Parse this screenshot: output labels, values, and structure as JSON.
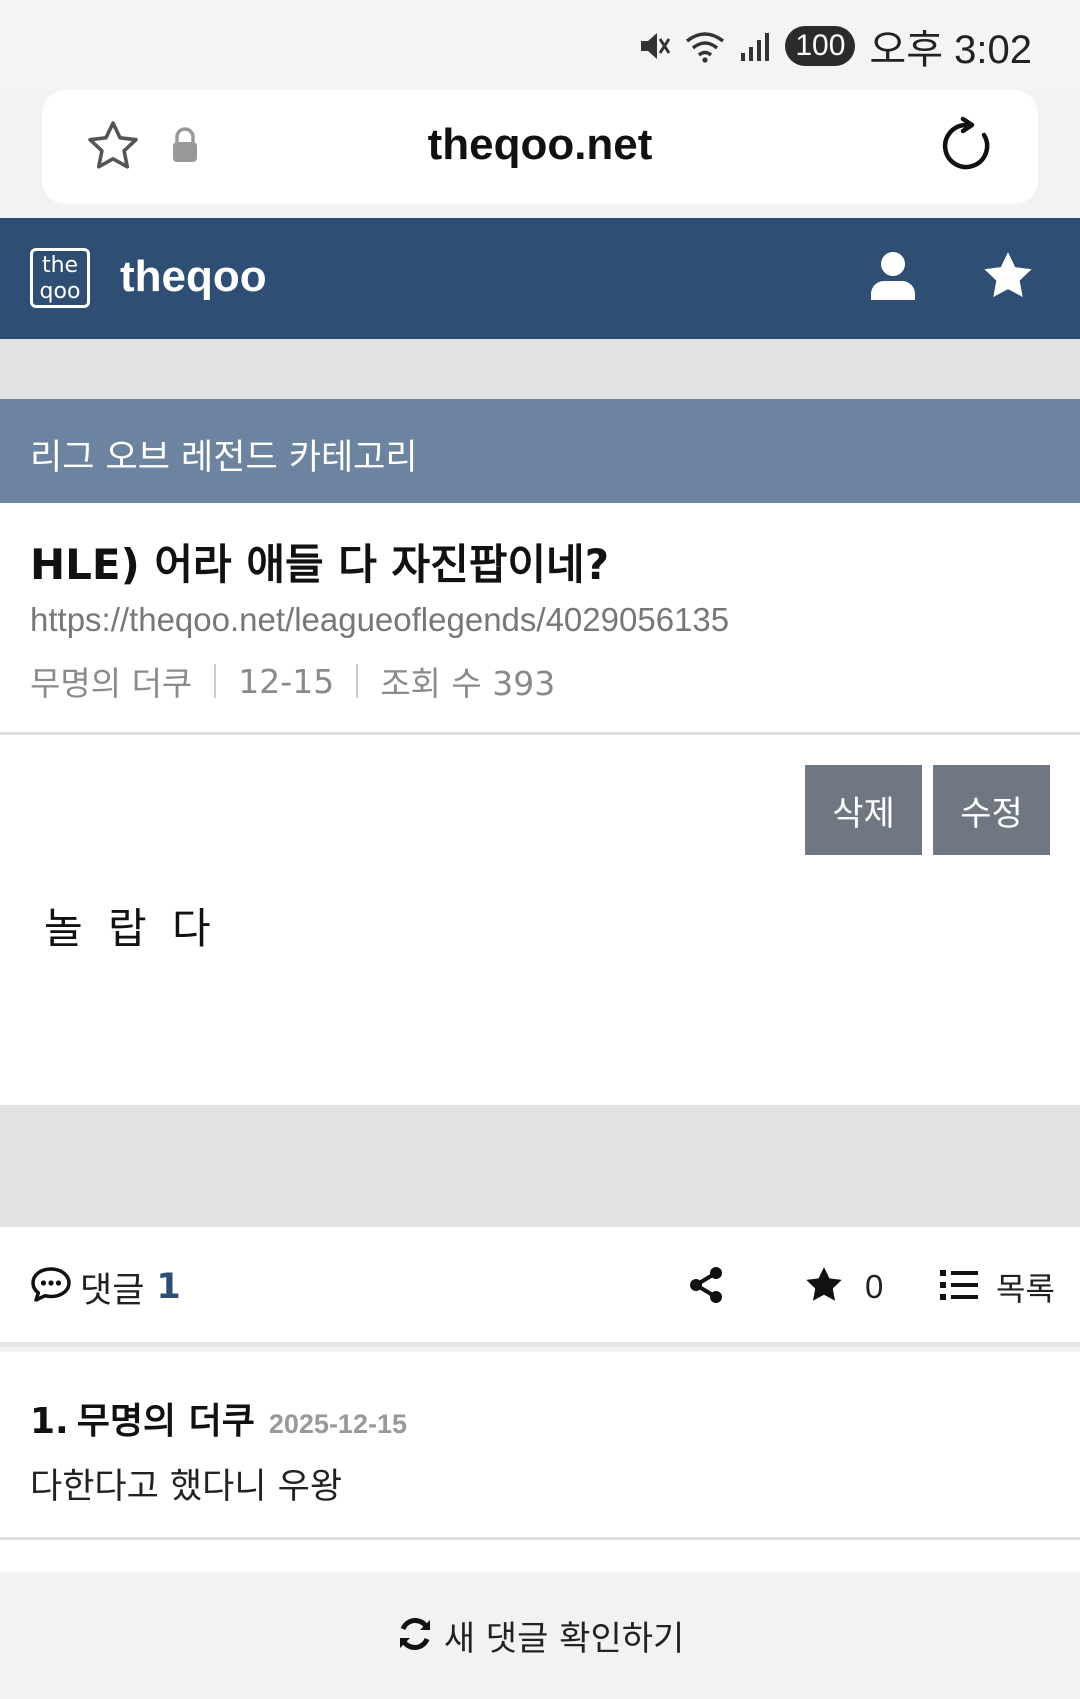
{
  "status_bar": {
    "battery": "100",
    "time": "오후 3:02",
    "icons": [
      "mute-icon",
      "wifi-icon",
      "signal-icon"
    ]
  },
  "browser": {
    "url": "theqoo.net",
    "icons": [
      "star-outline-icon",
      "lock-icon",
      "reload-icon"
    ]
  },
  "site_header": {
    "logo_top": "the",
    "logo_bottom": "qoo",
    "name": "theqoo",
    "icons": [
      "user-icon",
      "star-icon"
    ],
    "color": "#2e4f73"
  },
  "category": {
    "label": "리그 오브 레전드 카테고리",
    "color": "#6c849f"
  },
  "post": {
    "title": "HLE) 어라 애들 다 자진팝이네?",
    "url": "https://theqoo.net/leagueoflegends/4029056135",
    "author": "무명의 더쿠",
    "date": "12-15",
    "views": "조회 수 393",
    "delete_label": "삭제",
    "edit_label": "수정",
    "content": "놀 랍 다"
  },
  "actions": {
    "comments_label": "댓글",
    "comments_count": "1",
    "favorites_count": "0",
    "list_label": "목록",
    "icons": [
      "comment-icon",
      "share-icon",
      "star-icon",
      "list-icon"
    ]
  },
  "comments": [
    {
      "num": "1.",
      "author": "무명의 더쿠",
      "date": "2025-12-15",
      "text": "다한다고 했다니 우왕"
    }
  ],
  "refresh": {
    "label": "새 댓글 확인하기",
    "icon": "refresh-icon"
  }
}
